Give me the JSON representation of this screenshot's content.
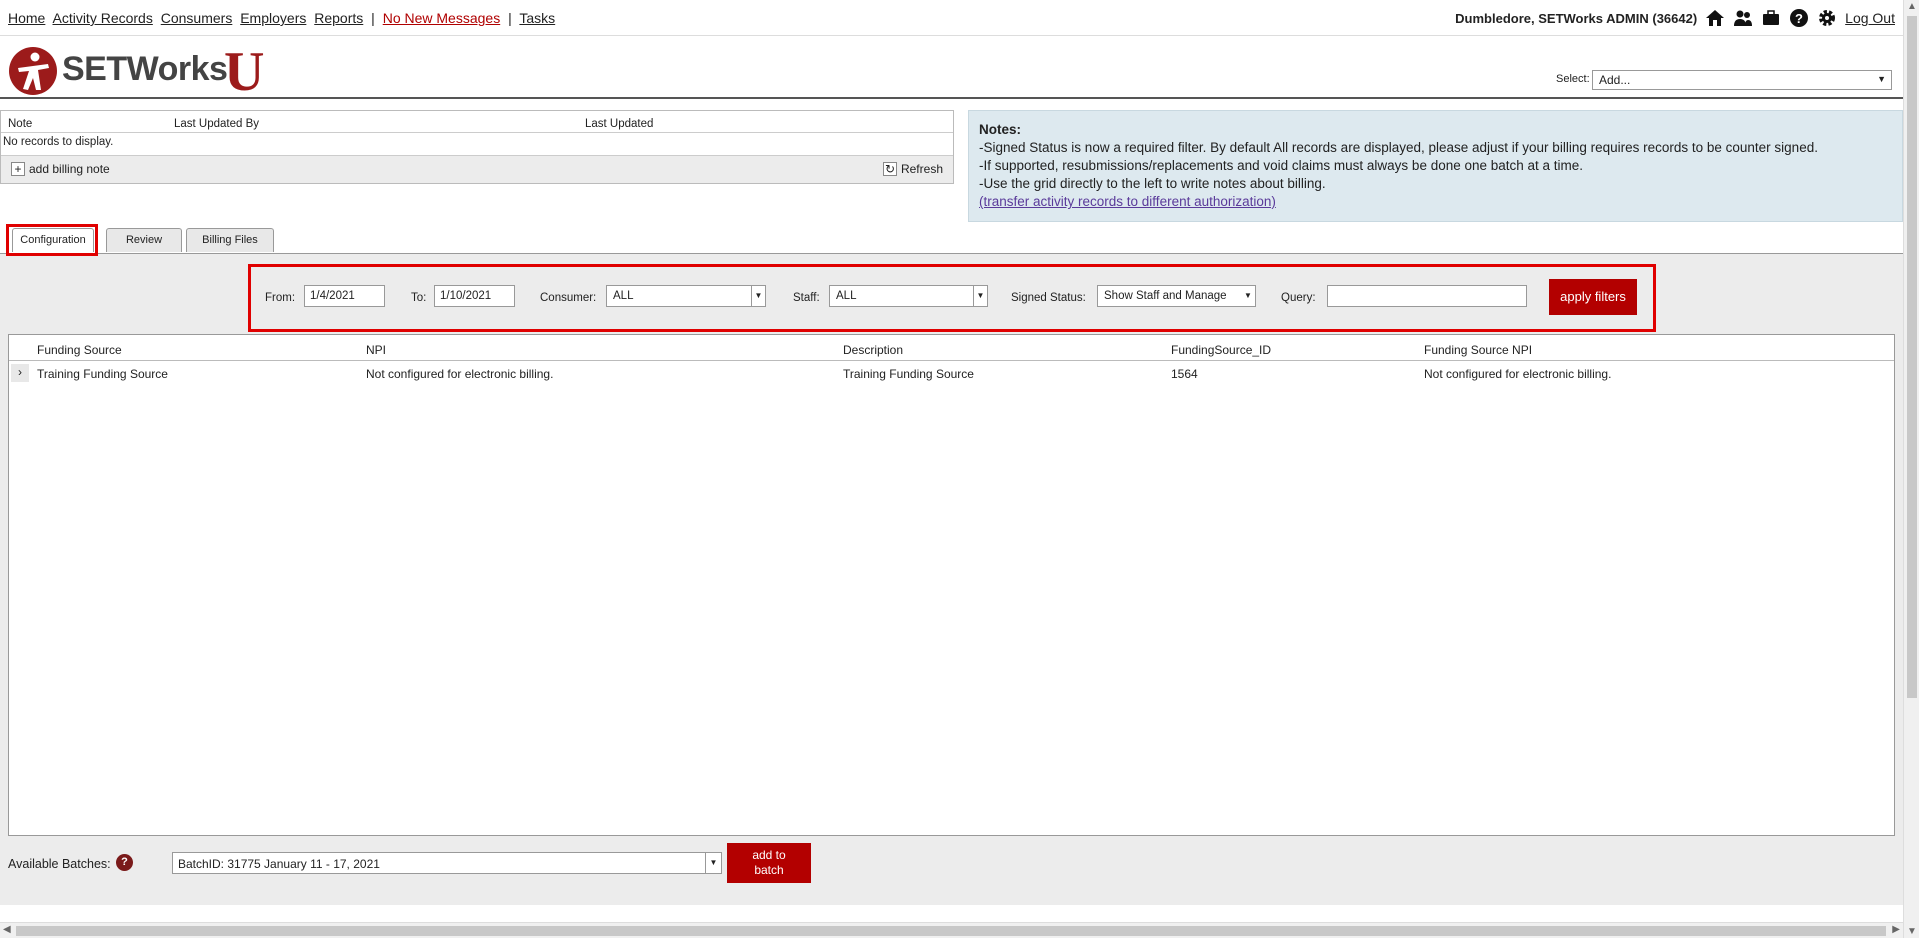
{
  "nav": {
    "links": [
      "Home",
      "Activity Records",
      "Consumers",
      "Employers",
      "Reports"
    ],
    "sep": "|",
    "messages": "No New Messages",
    "tasks": "Tasks",
    "user": "Dumbledore, SETWorks ADMIN (36642)",
    "logout": "Log Out"
  },
  "logo": {
    "text": "SETWorks",
    "u": "U"
  },
  "select": {
    "label": "Select:",
    "value": "Add..."
  },
  "notes_grid": {
    "columns": [
      "Note",
      "Last Updated By",
      "Last Updated"
    ],
    "empty": "No records to display.",
    "add_label": "add billing note",
    "refresh_label": "Refresh"
  },
  "notes_box": {
    "title": "Notes:",
    "lines": [
      "-Signed Status is now a required filter. By default All records are displayed, please adjust if your billing requires records to be counter signed.",
      "-If supported, resubmissions/replacements and void claims must always be done one batch at a time.",
      "-Use the grid directly to the left to write notes about billing."
    ],
    "link": "(transfer activity records to different authorization)"
  },
  "tabs": [
    "Configuration",
    "Review",
    "Billing Files"
  ],
  "filters": {
    "from_label": "From:",
    "from_value": "1/4/2021",
    "to_label": "To:",
    "to_value": "1/10/2021",
    "consumer_label": "Consumer:",
    "consumer_value": "ALL",
    "staff_label": "Staff:",
    "staff_value": "ALL",
    "signed_label": "Signed Status:",
    "signed_value": "Show Staff and Manage",
    "query_label": "Query:",
    "query_value": "",
    "apply_label": "apply filters"
  },
  "grid": {
    "columns": [
      "Funding Source",
      "NPI",
      "Description",
      "FundingSource_ID",
      "Funding Source NPI"
    ],
    "rows": [
      [
        "Training Funding Source",
        "Not configured for electronic billing.",
        "Training Funding Source",
        "1564",
        "Not configured for electronic billing."
      ]
    ]
  },
  "batches": {
    "label": "Available Batches:",
    "help": "?",
    "value": "BatchID: 31775 January 11 - 17, 2021",
    "add_label_1": "add to",
    "add_label_2": "batch"
  },
  "colors": {
    "accent": "#b30000",
    "notes_bg": "#dde9ef",
    "highlight": "#e00000"
  }
}
